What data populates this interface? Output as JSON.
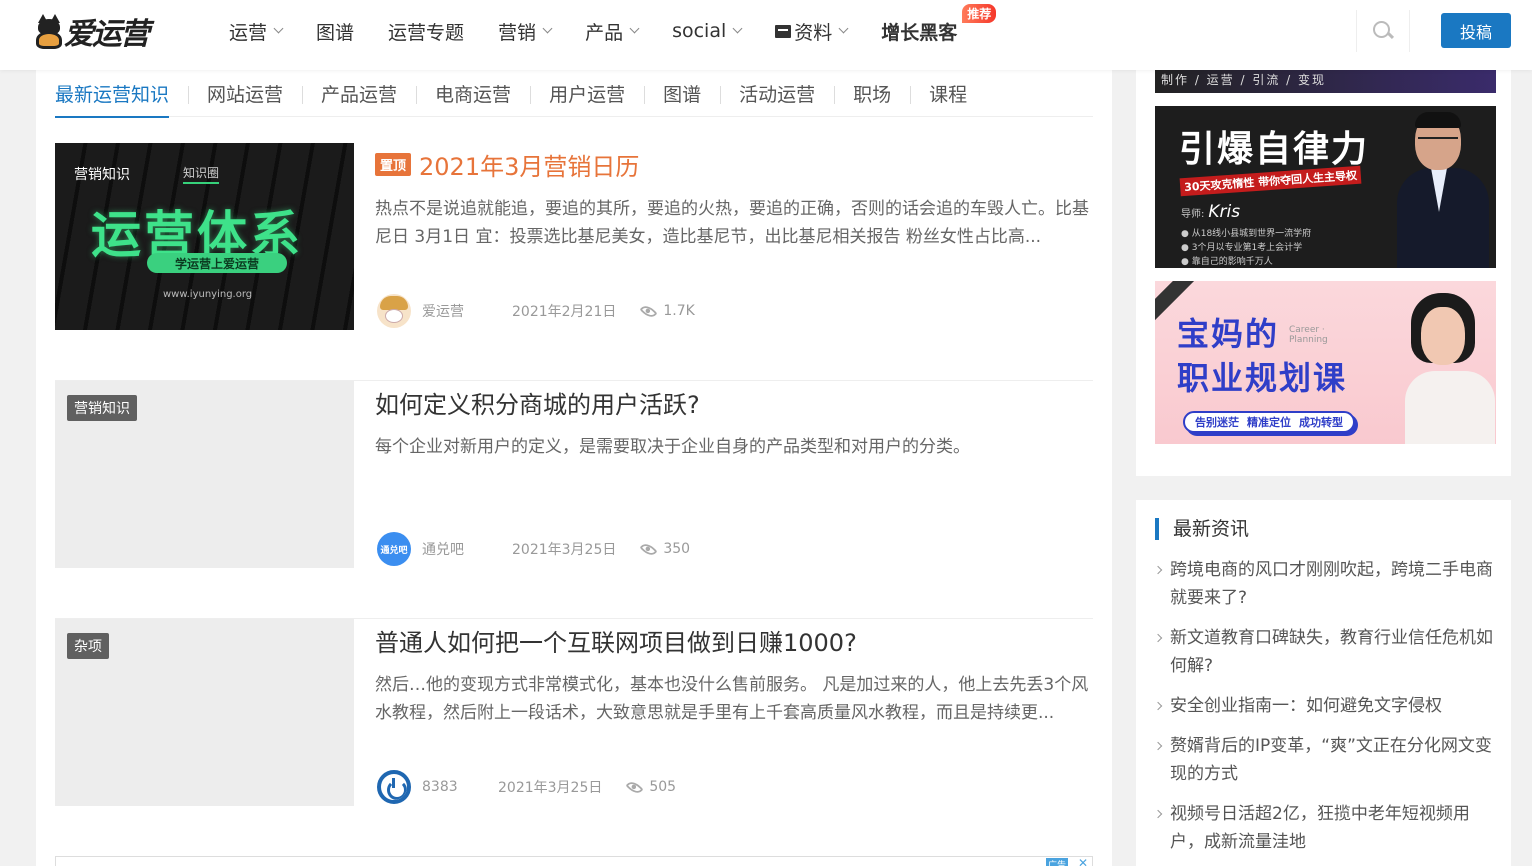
{
  "header": {
    "logo_text": "爱运营",
    "nav": [
      {
        "label": "运营",
        "dropdown": true
      },
      {
        "label": "图谱",
        "dropdown": false
      },
      {
        "label": "运营专题",
        "dropdown": false
      },
      {
        "label": "营销",
        "dropdown": true
      },
      {
        "label": "产品",
        "dropdown": true
      },
      {
        "label": "social",
        "dropdown": true
      },
      {
        "label": "资料",
        "dropdown": true,
        "icon": "folder-icon"
      },
      {
        "label": "增长黑客",
        "dropdown": false,
        "badge": "推荐"
      }
    ],
    "search_icon": "search-icon",
    "submit_label": "投稿",
    "accent_color": "#1a78c2"
  },
  "tabs": [
    {
      "label": "最新运营知识",
      "active": true
    },
    {
      "label": "网站运营",
      "active": false
    },
    {
      "label": "产品运营",
      "active": false
    },
    {
      "label": "电商运营",
      "active": false
    },
    {
      "label": "用户运营",
      "active": false
    },
    {
      "label": "图谱",
      "active": false
    },
    {
      "label": "活动运营",
      "active": false
    },
    {
      "label": "职场",
      "active": false
    },
    {
      "label": "课程",
      "active": false
    }
  ],
  "articles": [
    {
      "category": "营销知识",
      "sticky_label": "置顶",
      "title": "2021年3月营销日历",
      "description": "热点不是说追就能追，要追的其所，要追的火热，要追的正确，否则的话会追的车毁人亡。比基尼日 3月1日 宜：投票选比基尼美女，造比基尼节，出比基尼相关报告 粉丝女性占比高...",
      "author": "爱运营",
      "date": "2021年2月21日",
      "views": "1.7K",
      "thumb": {
        "badge": "知识圈",
        "headline": "运营体系",
        "pill": "学运营上爱运营",
        "url": "www.iyunying.org"
      }
    },
    {
      "category": "营销知识",
      "title": "如何定义积分商城的用户活跃?",
      "description": "每个企业对新用户的定义，是需要取决于企业自身的产品类型和对用户的分类。",
      "author": "通兑吧",
      "avatar_text": "通兑吧",
      "date": "2021年3月25日",
      "views": "350"
    },
    {
      "category": "杂项",
      "title": "普通人如何把一个互联网项目做到日赚1000?",
      "description": "然后…他的变现方式非常模式化，基本也没什么售前服务。 凡是加过来的人，他上去先丢3个风水教程，然后附上一段话术，大致意思就是手里有上千套高质量风水教程，而且是持续更...",
      "author": "8383",
      "date": "2021年3月25日",
      "views": "505"
    }
  ],
  "bottom_ad": {
    "label": "广告",
    "close": "✕"
  },
  "sidebar": {
    "banner1_text": "制作 / 运营 / 引流 / 变现",
    "banner2": {
      "title": "引爆自律力",
      "subtitle": "30天攻克惰性 带你夺回人生主导权",
      "author_prefix": "导师:",
      "author": "Kris",
      "lines": [
        "● 从18线小县城到世界一流学府",
        "● 3个月以专业第1考上会计学",
        "● 靠自己的影响千万人"
      ]
    },
    "banner3": {
      "title_line1": "宝妈的",
      "en_line1": "Career ·",
      "en_line2": "Planning",
      "title_line2": "职业规划课",
      "pills": [
        "告别迷茫",
        "精准定位",
        "成功转型"
      ]
    },
    "news": {
      "heading": "最新资讯",
      "items": [
        "跨境电商的风口才刚刚吹起，跨境二手电商就要来了?",
        "新文道教育口碑缺失，教育行业信任危机如何解?",
        "安全创业指南一：如何避免文字侵权",
        "赘婿背后的IP变革，“爽”文正在分化网文变现的方式",
        "视频号日活超2亿，狂揽中老年短视频用户，成新流量洼地"
      ]
    }
  }
}
